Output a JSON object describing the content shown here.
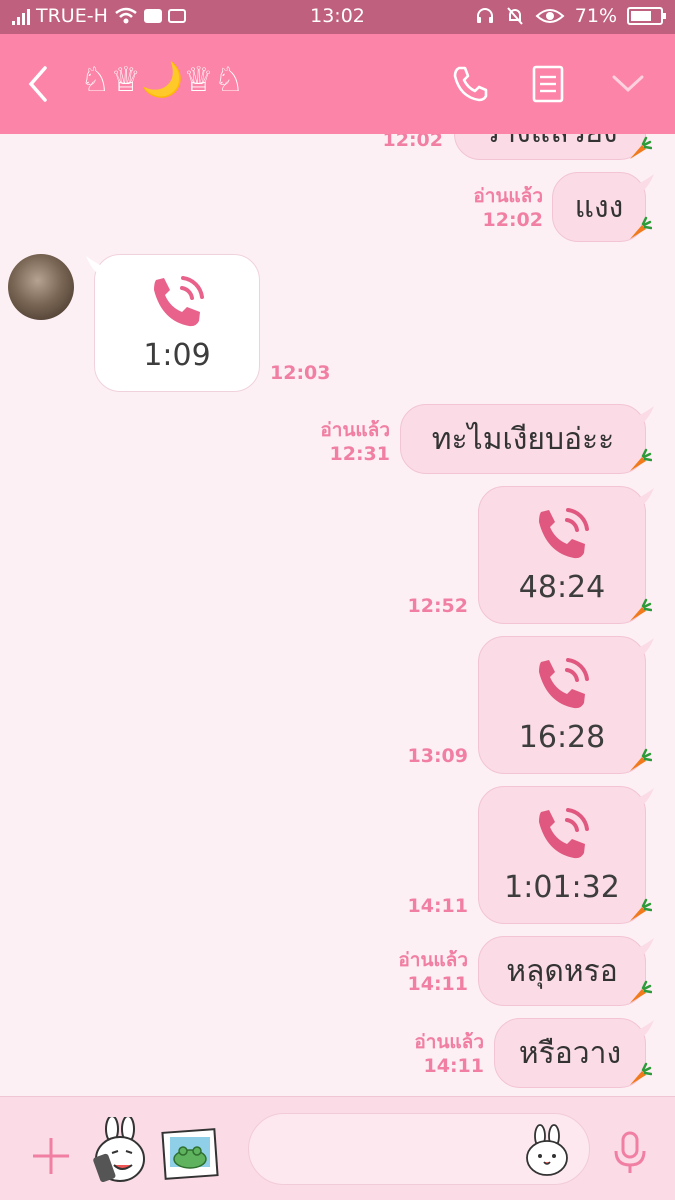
{
  "status_bar": {
    "carrier": "TRUE-H",
    "time": "13:02",
    "battery": "71%",
    "battery_level": 0.71
  },
  "header": {
    "title": "♘♕🌙♕♘",
    "back_icon": "chevron-left-icon",
    "call_icon": "phone-icon",
    "notes_icon": "notes-icon",
    "menu_icon": "chevron-down-icon"
  },
  "messages": [
    {
      "side": "out",
      "text": "ว่างแล้วยัง",
      "time": "12:02",
      "read": ""
    },
    {
      "side": "out",
      "text": "แงง",
      "time": "12:02",
      "read": "อ่านแล้ว"
    },
    {
      "side": "in",
      "type": "call",
      "duration": "1:09",
      "time": "12:03"
    },
    {
      "side": "out",
      "text": "ทะไมเงียบอ่ะะ",
      "time": "12:31",
      "read": "อ่านแล้ว"
    },
    {
      "side": "out",
      "type": "call",
      "duration": "48:24",
      "time": "12:52"
    },
    {
      "side": "out",
      "type": "call",
      "duration": "16:28",
      "time": "13:09"
    },
    {
      "side": "out",
      "type": "call",
      "duration": "1:01:32",
      "time": "14:11"
    },
    {
      "side": "out",
      "text": "หลุดหรอ",
      "time": "14:11",
      "read": "อ่านแล้ว"
    },
    {
      "side": "out",
      "text": "หรือวาง",
      "time": "14:11",
      "read": "อ่านแล้ว"
    }
  ],
  "input": {
    "placeholder": "",
    "value": ""
  },
  "colors": {
    "header": "#fc84a8",
    "status_bar": "#c0607f",
    "background": "#fdf0f4",
    "bubble_out": "#fadbe6",
    "bubble_in": "#ffffff",
    "meta_text": "#f07fa3",
    "call_icon": "#e0577f"
  }
}
